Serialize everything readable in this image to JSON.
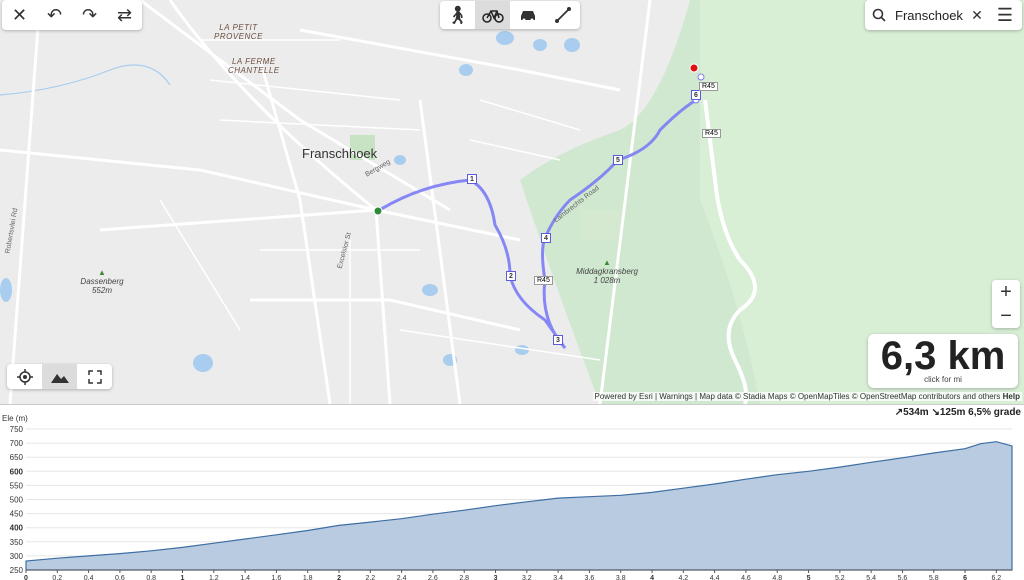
{
  "toolbar": {
    "close_icon": "close-icon",
    "undo_icon": "undo-icon",
    "redo_icon": "redo-icon",
    "reverse_icon": "swap-icon"
  },
  "modes": [
    {
      "name": "walk",
      "icon": "walking-icon",
      "active": false
    },
    {
      "name": "bike",
      "icon": "bicycle-icon",
      "active": true
    },
    {
      "name": "car",
      "icon": "car-icon",
      "active": false
    },
    {
      "name": "straight",
      "icon": "straight-line-icon",
      "active": false
    }
  ],
  "search": {
    "value": "Franschoek"
  },
  "map": {
    "places": [
      {
        "text": "LA PETIT\nPROVENCE"
      },
      {
        "text": "LA FERME\nCHANTELLE"
      }
    ],
    "town": "Franschhoek",
    "streets": [
      "Bergweg",
      "Excelsior St",
      "Robertsvlei Rd",
      "Lambrechts Road"
    ],
    "peaks": [
      {
        "name": "Dassenberg",
        "ele": "552m"
      },
      {
        "name": "Middagkransberg",
        "ele": "1 028m"
      }
    ],
    "road_labels": [
      "R45",
      "R45",
      "R45"
    ],
    "waypoints": [
      "1",
      "2",
      "3",
      "4",
      "5",
      "6"
    ]
  },
  "distance": {
    "value": "6,3 km",
    "sub": "click for mi"
  },
  "zoom": {
    "in": "+",
    "out": "−"
  },
  "attribution": {
    "powered": "Powered by Esri",
    "warnings": "Warnings",
    "data": "Map data © Stadia Maps © OpenMapTiles © OpenStreetMap contributors and others",
    "help": "Help"
  },
  "elevation": {
    "ylabel": "Ele (m)",
    "stats": "↗534m ↘125m 6,5% grade",
    "yticks": [
      "750",
      "700",
      "650",
      "600",
      "550",
      "500",
      "450",
      "400",
      "350",
      "300",
      "250"
    ],
    "xticks": [
      "0",
      "0,2",
      "0,4",
      "0,6",
      "0,8",
      "1",
      "1,2",
      "1,4",
      "1,6",
      "1,8",
      "2",
      "2,2",
      "2,4",
      "2,6",
      "2,8",
      "3",
      "3,2",
      "3,4",
      "3,6",
      "3,8",
      "4",
      "4,2",
      "4,4",
      "4,6",
      "4,8",
      "5",
      "5,2",
      "5,4",
      "5,6",
      "5,8",
      "6",
      "6,2"
    ],
    "profile_km": [
      0,
      0.2,
      0.4,
      0.6,
      0.8,
      1.0,
      1.2,
      1.4,
      1.6,
      1.8,
      2.0,
      2.2,
      2.4,
      2.6,
      2.8,
      3.0,
      3.2,
      3.4,
      3.6,
      3.8,
      4.0,
      4.2,
      4.4,
      4.6,
      4.8,
      5.0,
      5.2,
      5.4,
      5.6,
      5.8,
      6.0,
      6.1,
      6.2,
      6.3
    ],
    "profile_m": [
      282,
      292,
      300,
      308,
      318,
      330,
      345,
      360,
      375,
      390,
      408,
      420,
      432,
      448,
      462,
      478,
      492,
      505,
      510,
      515,
      525,
      540,
      555,
      572,
      588,
      600,
      615,
      632,
      648,
      665,
      680,
      698,
      705,
      690
    ]
  }
}
